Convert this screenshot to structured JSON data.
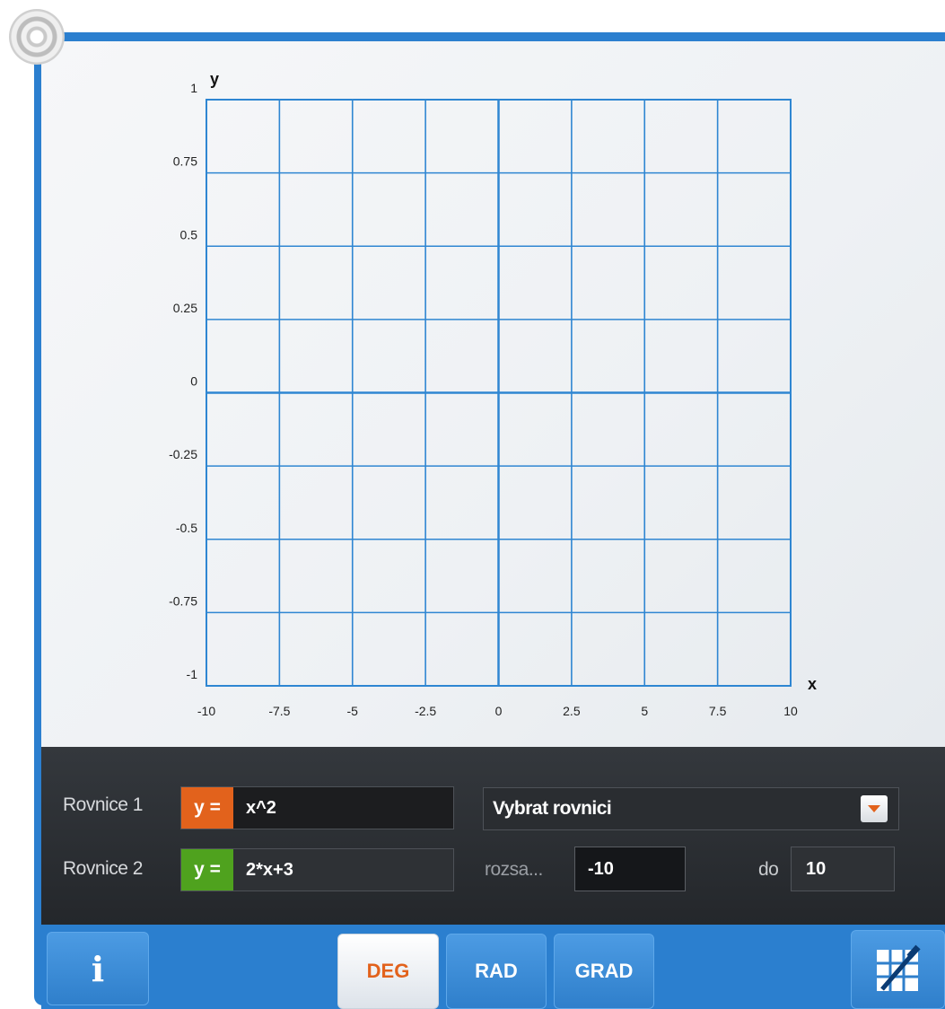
{
  "chart_data": {
    "type": "line",
    "title": "",
    "xlabel": "x",
    "ylabel": "y",
    "xlim": [
      -10,
      10
    ],
    "ylim": [
      -1,
      1
    ],
    "x_ticks": [
      "-10",
      "-7.5",
      "-5",
      "-2.5",
      "0",
      "2.5",
      "5",
      "7.5",
      "10"
    ],
    "y_ticks": [
      "1",
      "0.75",
      "0.5",
      "0.25",
      "0",
      "-0.25",
      "-0.5",
      "-0.75",
      "-1"
    ],
    "grid": true,
    "series": []
  },
  "colors": {
    "frame": "#2b7fcf",
    "grid": "#2f86d2",
    "eq1_tag": "#e2621c",
    "eq2_tag": "#4fa21e",
    "active_mode": "#e2621c"
  },
  "equations": {
    "eq1": {
      "label": "Rovnice 1",
      "prefix": "y =",
      "value": "x^2"
    },
    "eq2": {
      "label": "Rovnice 2",
      "prefix": "y =",
      "value": "2*x+3"
    }
  },
  "select": {
    "label": "Vybrat rovnici",
    "icon": "chevron-down-icon"
  },
  "range": {
    "label": "rozsa...",
    "from": "-10",
    "to_label": "do",
    "to": "10"
  },
  "toolbar": {
    "info_icon": "info-icon",
    "modes": [
      "DEG",
      "RAD",
      "GRAD"
    ],
    "active_mode": "DEG",
    "graph_tool_icon": "graph-edit-icon"
  }
}
